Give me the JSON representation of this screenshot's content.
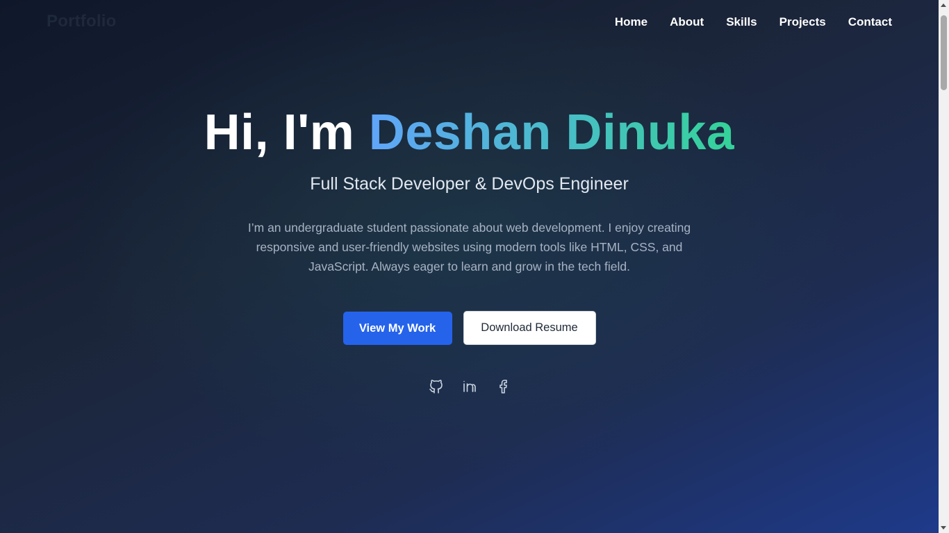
{
  "nav": {
    "logo": "Portfolio",
    "links": [
      "Home",
      "About",
      "Skills",
      "Projects",
      "Contact"
    ]
  },
  "hero": {
    "greeting": "Hi, I'm",
    "name": "Deshan Dinuka",
    "role": "Full Stack Developer & DevOps Engineer",
    "bio": "I’m an undergraduate student passionate about web development. I enjoy creating responsive and user-friendly websites using modern tools like HTML, CSS, and JavaScript. Always eager to learn and grow in the tech field.",
    "primary_button": "View My Work",
    "secondary_button": "Download Resume"
  },
  "socials": [
    {
      "icon": "github-icon"
    },
    {
      "icon": "linkedin-icon"
    },
    {
      "icon": "facebook-icon"
    }
  ],
  "colors": {
    "background_start": "#0f172a",
    "background_end": "#1e3a8a",
    "name_gradient_start": "#60a5fa",
    "name_gradient_end": "#34d399",
    "primary_button": "#2563eb"
  }
}
